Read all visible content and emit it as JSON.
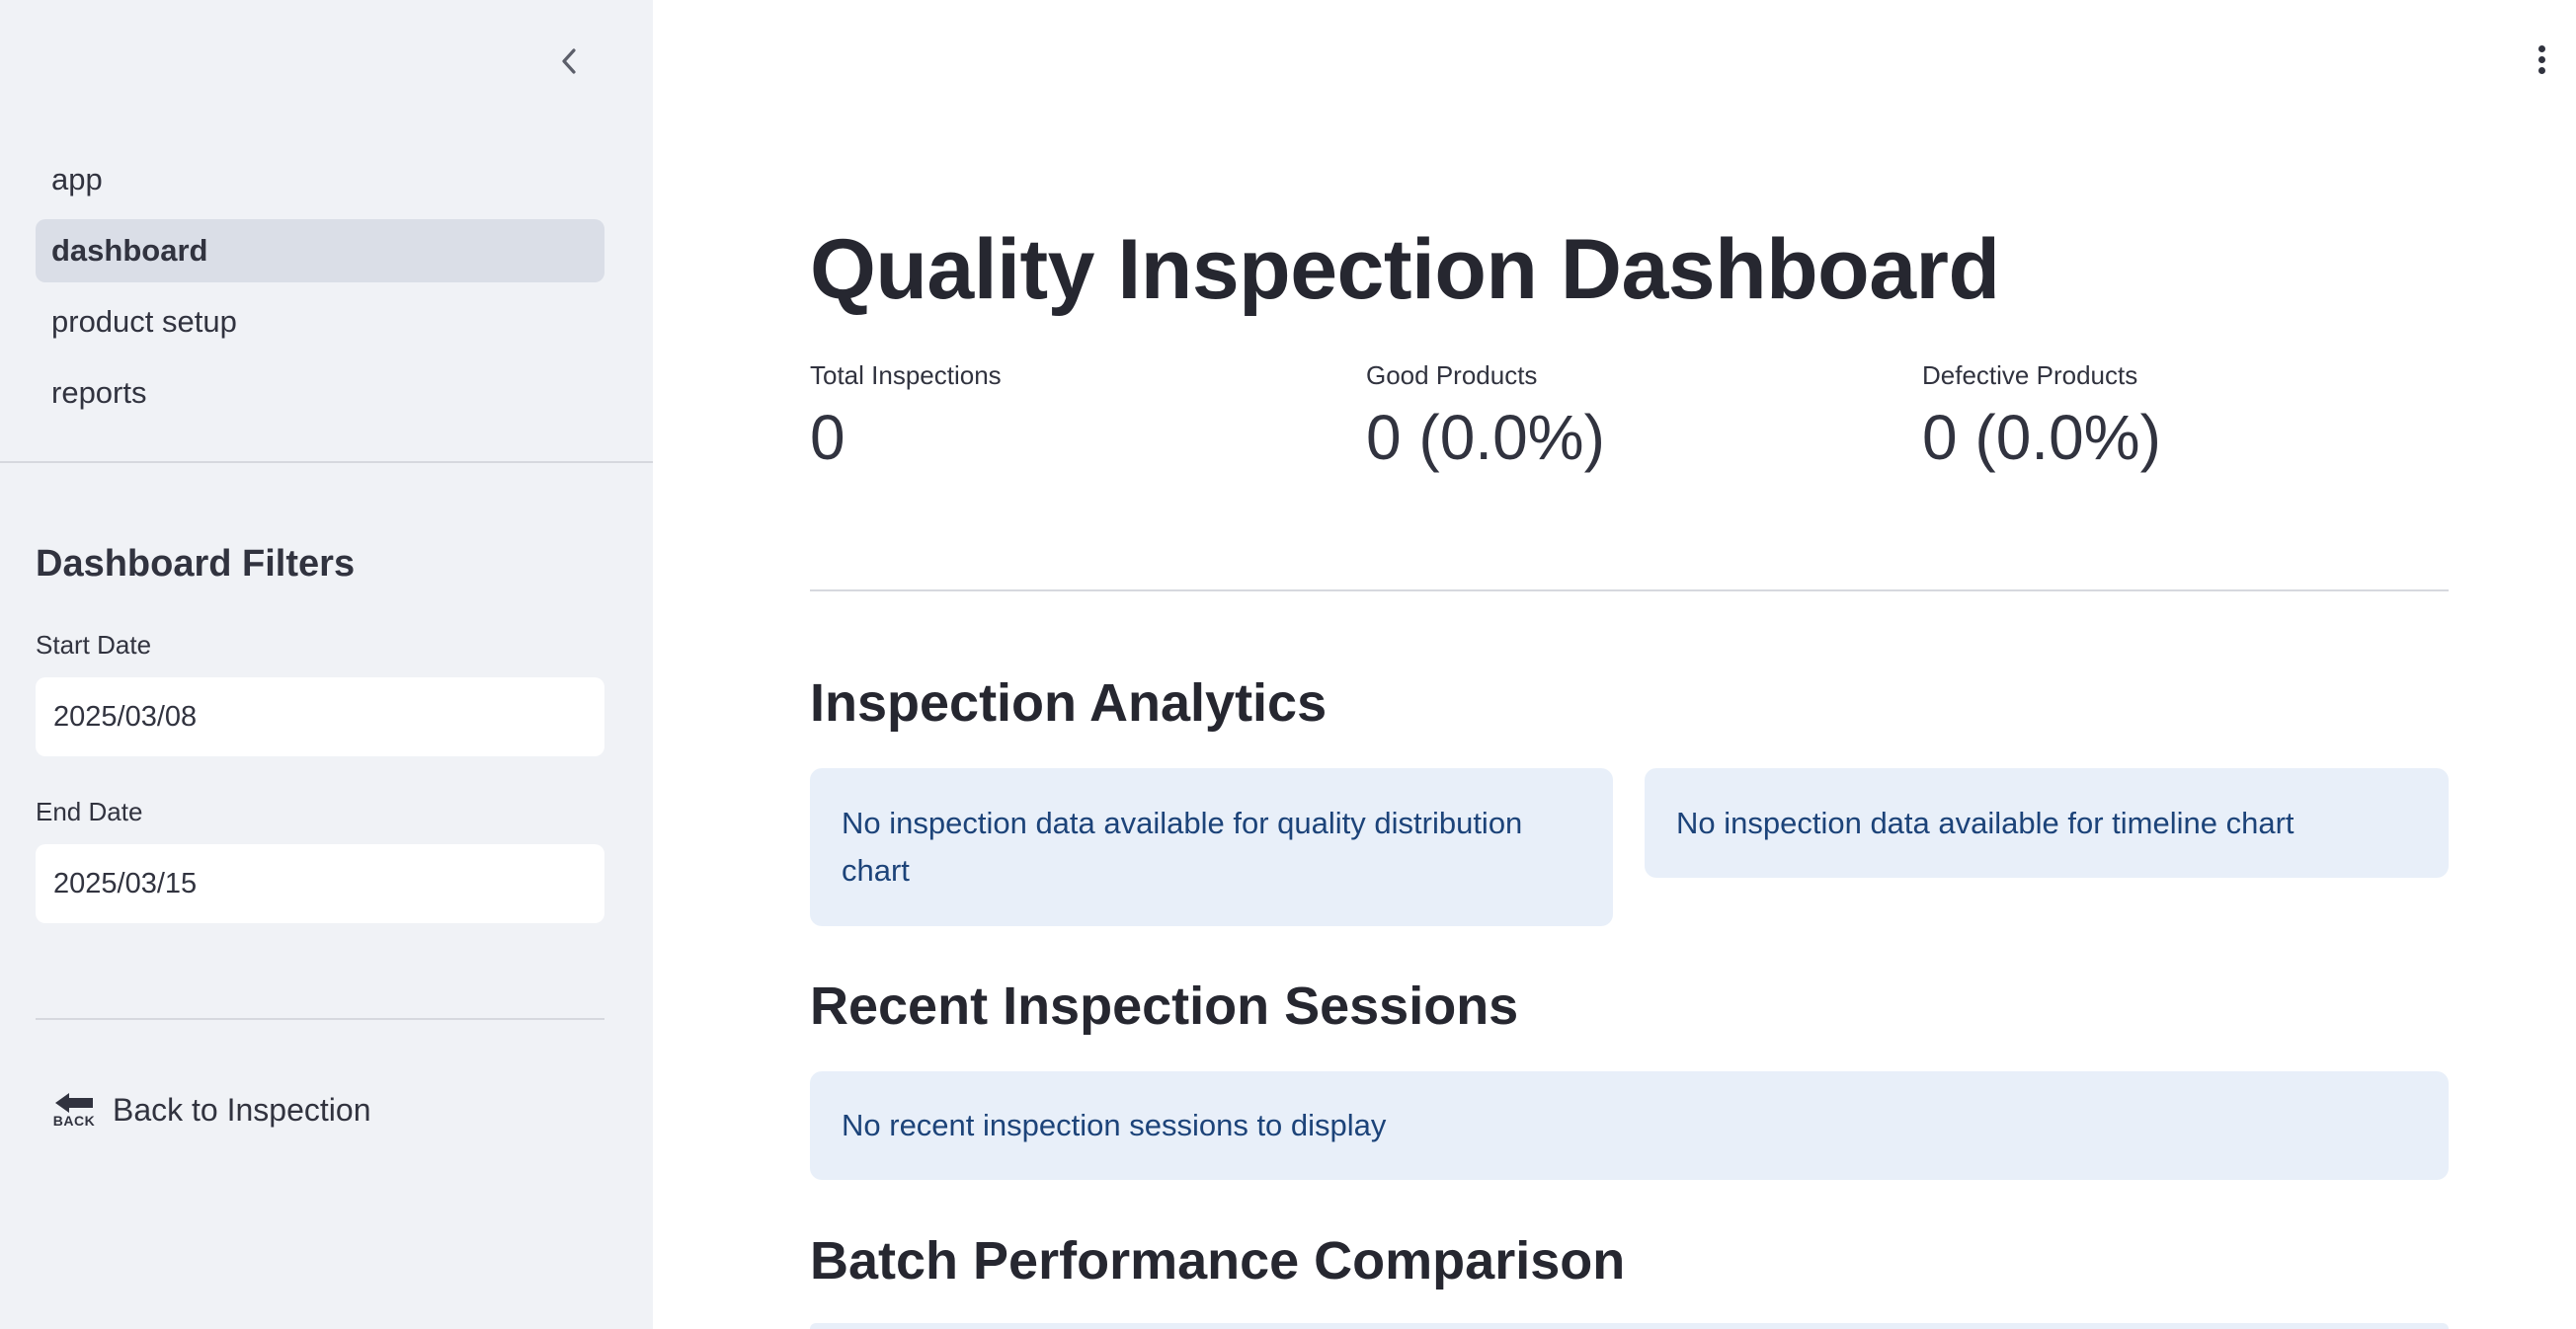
{
  "sidebar": {
    "nav_items": [
      {
        "label": "app",
        "active": false
      },
      {
        "label": "dashboard",
        "active": true
      },
      {
        "label": "product setup",
        "active": false
      },
      {
        "label": "reports",
        "active": false
      }
    ],
    "filters_title": "Dashboard Filters",
    "start_date": {
      "label": "Start Date",
      "value": "2025/03/08"
    },
    "end_date": {
      "label": "End Date",
      "value": "2025/03/15"
    },
    "back_button": {
      "icon_text": "BACK",
      "label": "Back to Inspection"
    }
  },
  "main": {
    "title": "Quality Inspection Dashboard",
    "metrics": [
      {
        "label": "Total Inspections",
        "value": "0"
      },
      {
        "label": "Good Products",
        "value": "0 (0.0%)"
      },
      {
        "label": "Defective Products",
        "value": "0 (0.0%)"
      }
    ],
    "analytics": {
      "title": "Inspection Analytics",
      "quality_distribution_message": "No inspection data available for quality distribution chart",
      "timeline_message": "No inspection data available for timeline chart"
    },
    "recent_sessions": {
      "title": "Recent Inspection Sessions",
      "message": "No recent inspection sessions to display"
    },
    "batch_performance": {
      "title": "Batch Performance Comparison"
    }
  },
  "colors": {
    "sidebar_bg": "#f0f2f6",
    "active_nav_bg": "#dadee7",
    "info_bg": "#e8eff9",
    "info_text": "#1c4379",
    "text": "#31333f"
  }
}
